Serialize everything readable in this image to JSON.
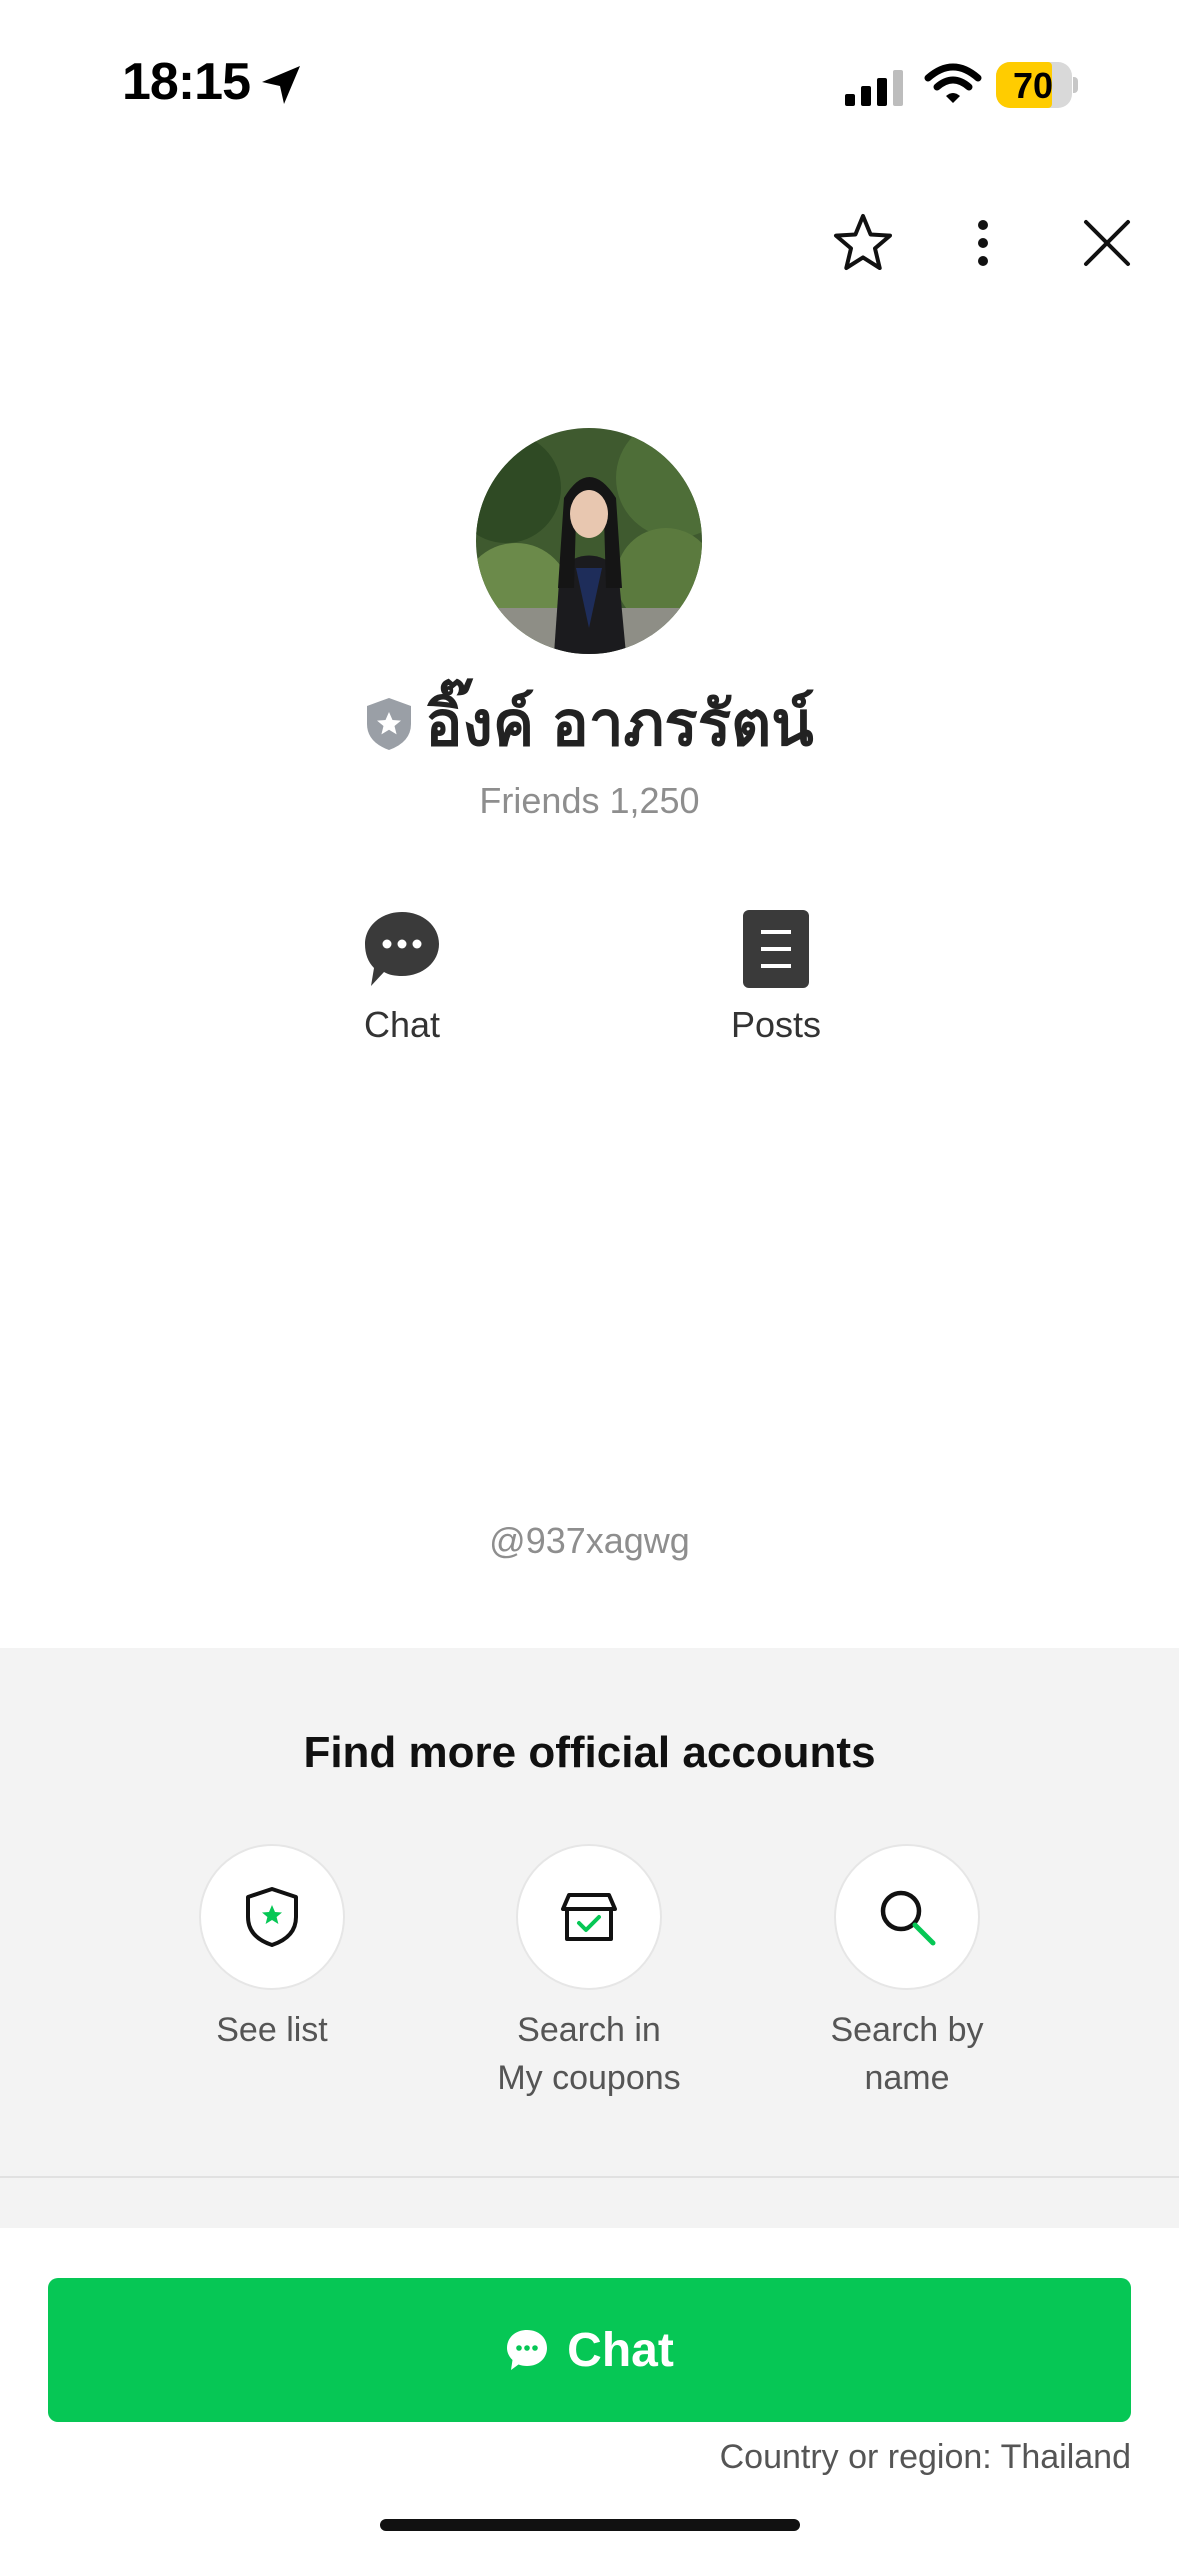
{
  "status_bar": {
    "time": "18:15",
    "battery": "70",
    "icons": [
      "location-arrow-icon",
      "cellular-signal-icon",
      "wifi-icon",
      "battery-icon"
    ]
  },
  "header": {
    "icons": [
      "star-icon",
      "more-vertical-icon",
      "close-icon"
    ]
  },
  "profile": {
    "name": "อิ๊งค์ อาภรรัตน์",
    "friends": "Friends 1,250",
    "handle": "@937xagwg",
    "badge_icon": "official-shield-icon"
  },
  "actions": [
    {
      "label": "Chat",
      "icon": "chat-bubble-icon"
    },
    {
      "label": "Posts",
      "icon": "document-icon"
    }
  ],
  "more_accounts": {
    "title": "Find more official accounts",
    "items": [
      {
        "label_line1": "See list",
        "label_line2": "",
        "icon": "shield-star-icon"
      },
      {
        "label_line1": "Search in",
        "label_line2": "My coupons",
        "icon": "coupon-box-icon"
      },
      {
        "label_line1": "Search by",
        "label_line2": "name",
        "icon": "search-icon"
      }
    ]
  },
  "footer": {
    "chat_button_label": "Chat",
    "region": "Country or region: Thailand"
  },
  "colors": {
    "accent_green": "#06c755",
    "section_gray": "#f3f3f3",
    "battery_yellow": "#ffcc00"
  }
}
